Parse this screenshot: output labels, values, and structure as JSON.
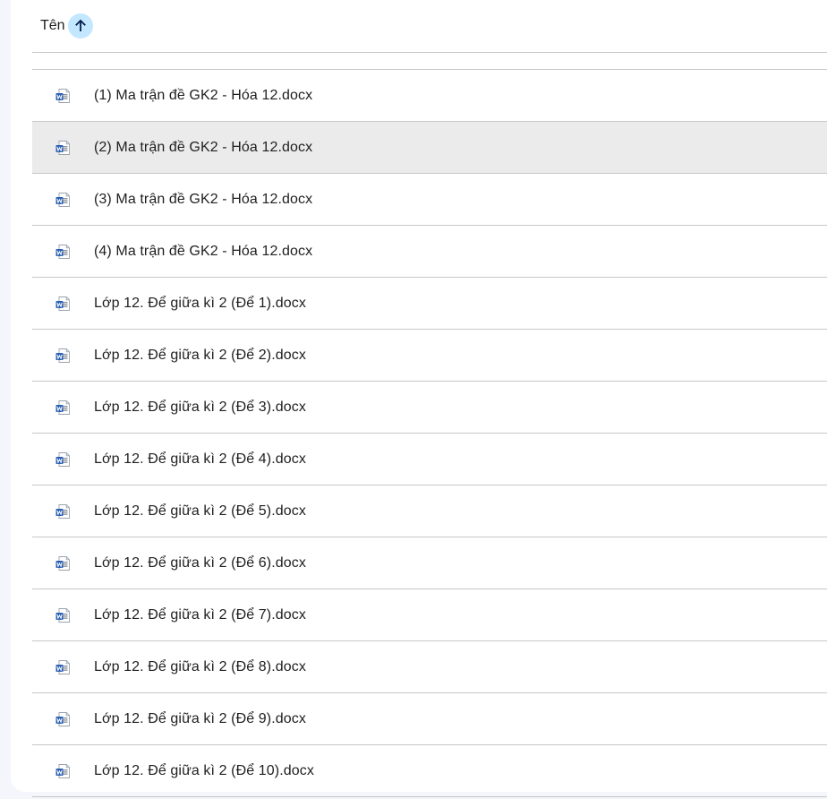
{
  "header": {
    "column_label": "Tên",
    "sort_icon": "arrow-up-icon"
  },
  "colors": {
    "sort_button_bg": "#c2e7ff",
    "selected_row_bg": "#ebebeb",
    "word_icon_blue": "#2b5fb3",
    "divider": "#c7c7c7"
  },
  "files": [
    {
      "name": "(1) Ma trận đề GK2 - Hóa 12.docx",
      "icon": "word-doc-icon"
    },
    {
      "name": "(2) Ma trận đề GK2 - Hóa 12.docx",
      "icon": "word-doc-icon",
      "selected": true
    },
    {
      "name": "(3) Ma trận đề GK2 - Hóa 12.docx",
      "icon": "word-doc-icon"
    },
    {
      "name": "(4) Ma trận đề GK2 - Hóa 12.docx",
      "icon": "word-doc-icon"
    },
    {
      "name": "Lớp 12. Để giữa kì 2 (Để 1).docx",
      "icon": "word-doc-icon"
    },
    {
      "name": "Lớp 12. Để giữa kì 2 (Để 2).docx",
      "icon": "word-doc-icon"
    },
    {
      "name": "Lớp 12. Để giữa kì 2 (Để 3).docx",
      "icon": "word-doc-icon"
    },
    {
      "name": "Lớp 12. Để giữa kì 2 (Để 4).docx",
      "icon": "word-doc-icon"
    },
    {
      "name": "Lớp 12. Để giữa kì 2 (Để 5).docx",
      "icon": "word-doc-icon"
    },
    {
      "name": "Lớp 12. Để giữa kì 2 (Để 6).docx",
      "icon": "word-doc-icon"
    },
    {
      "name": "Lớp 12. Để giữa kì 2 (Để 7).docx",
      "icon": "word-doc-icon"
    },
    {
      "name": "Lớp 12. Để giữa kì 2 (Để 8).docx",
      "icon": "word-doc-icon"
    },
    {
      "name": "Lớp 12. Để giữa kì 2 (Để 9).docx",
      "icon": "word-doc-icon"
    },
    {
      "name": "Lớp 12. Để giữa kì 2 (Để 10).docx",
      "icon": "word-doc-icon"
    }
  ]
}
